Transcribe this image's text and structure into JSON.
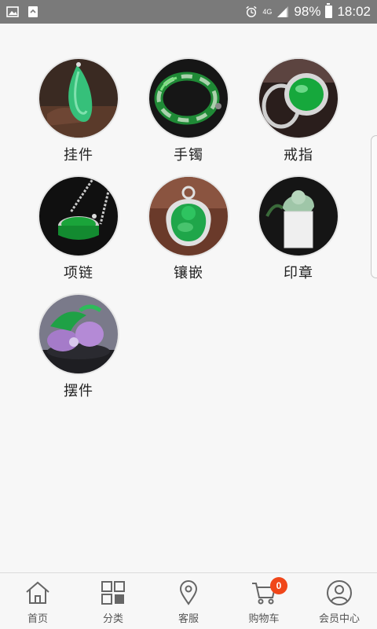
{
  "status_bar": {
    "network": "4G",
    "battery": "98%",
    "time": "18:02"
  },
  "categories": [
    {
      "label": "挂件",
      "icon": "jade-pendant"
    },
    {
      "label": "手镯",
      "icon": "jade-bangle"
    },
    {
      "label": "戒指",
      "icon": "jade-ring"
    },
    {
      "label": "项链",
      "icon": "jade-necklace"
    },
    {
      "label": "镶嵌",
      "icon": "jade-inlay"
    },
    {
      "label": "印章",
      "icon": "jade-seal"
    },
    {
      "label": "摆件",
      "icon": "jade-ornament"
    }
  ],
  "tab_bar": {
    "tabs": [
      {
        "label": "首页",
        "icon": "home-icon"
      },
      {
        "label": "分类",
        "icon": "grid-icon"
      },
      {
        "label": "客服",
        "icon": "location-pin-icon"
      },
      {
        "label": "购物车",
        "icon": "cart-icon",
        "badge": "0"
      },
      {
        "label": "会员中心",
        "icon": "user-icon"
      }
    ]
  },
  "colors": {
    "badge": "#f0471a",
    "jade": "#2bb64a",
    "status_bar": "#7a7a7a"
  }
}
